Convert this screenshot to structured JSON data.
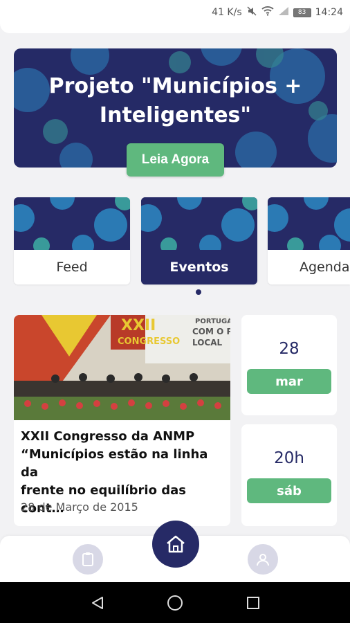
{
  "status_bar": {
    "speed": "41 K/s",
    "battery": "83",
    "time": "14:24"
  },
  "hero": {
    "title_line1": "Projeto \"Municípios +",
    "title_line2": "Inteligentes\"",
    "button_label": "Leia Agora"
  },
  "categories": [
    {
      "label": "Feed",
      "active": false
    },
    {
      "label": "Eventos",
      "active": true
    },
    {
      "label": "Agenda",
      "active": false
    }
  ],
  "event": {
    "title_line1": "XXII Congresso da ANMP",
    "title_line2": "“Municípios estão na linha da",
    "title_line3": "frente no equilíbrio das cont…",
    "date": "28 de Março de 2015",
    "photo_text_1": "XXII",
    "photo_text_2": "CONGRESSO",
    "photo_text_3": "PORTUGAL",
    "photo_text_4": "COM O POD",
    "photo_text_5": "LOCAL",
    "day": "28",
    "month": "mar",
    "hour": "20h",
    "weekday": "sáb"
  },
  "colors": {
    "navy": "#262a66",
    "green": "#5fb87e",
    "blue_dots": "#2e8fc9",
    "teal_dots": "#3fb6a8"
  },
  "icons": {
    "nav_left": "clipboard-icon",
    "nav_center": "home-icon",
    "nav_right": "user-icon"
  }
}
